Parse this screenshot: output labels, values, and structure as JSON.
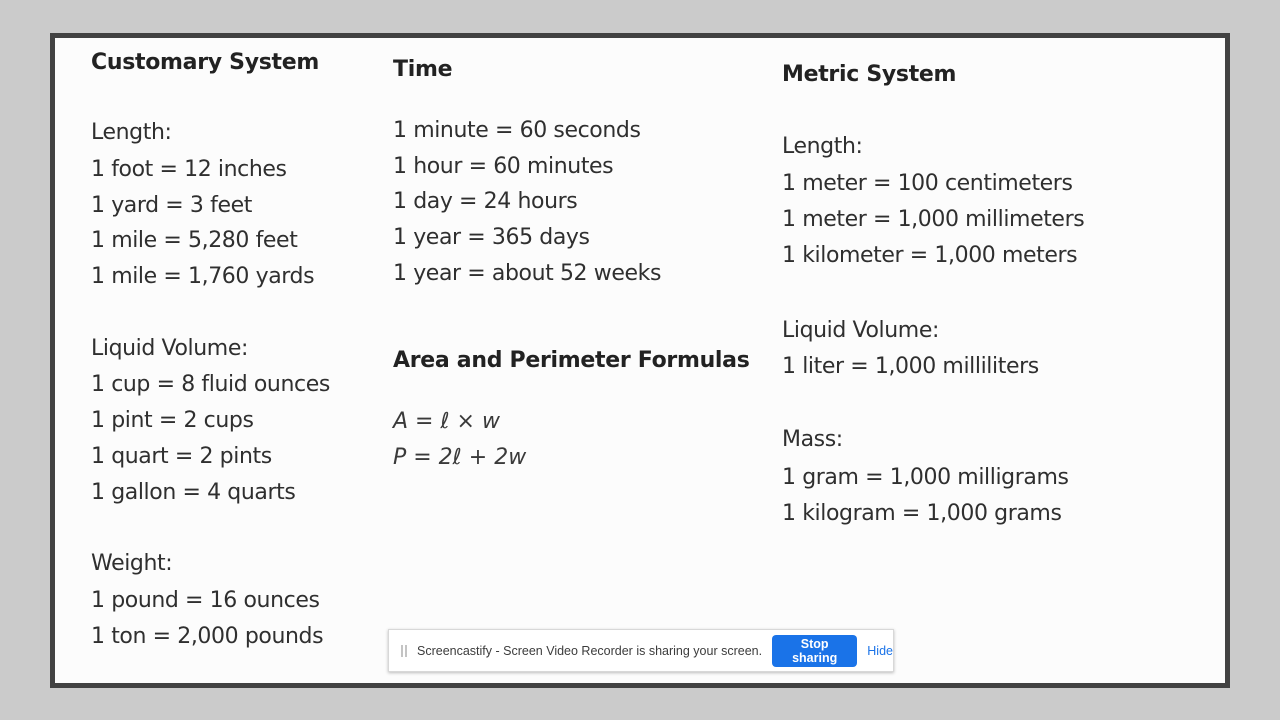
{
  "customary": {
    "title": "Customary System",
    "length": {
      "label": "Length:",
      "lines": [
        "1 foot = 12 inches",
        "1 yard = 3 feet",
        "1 mile = 5,280 feet",
        "1 mile = 1,760 yards"
      ]
    },
    "liquid_volume": {
      "label": "Liquid Volume:",
      "lines": [
        "1 cup = 8 fluid ounces",
        "1 pint = 2 cups",
        "1 quart = 2 pints",
        "1 gallon = 4 quarts"
      ]
    },
    "weight": {
      "label": "Weight:",
      "lines": [
        "1 pound = 16 ounces",
        "1 ton = 2,000 pounds"
      ]
    }
  },
  "time": {
    "title": "Time",
    "lines": [
      "1 minute = 60 seconds",
      "1 hour = 60 minutes",
      "1 day = 24 hours",
      "1 year = 365 days",
      "1 year = about 52 weeks"
    ]
  },
  "formulas": {
    "title": "Area and Perimeter Formulas",
    "lines": [
      "A = ℓ × w",
      "P = 2ℓ + 2w"
    ]
  },
  "metric": {
    "title": "Metric System",
    "length": {
      "label": "Length:",
      "lines": [
        "1 meter = 100 centimeters",
        "1 meter = 1,000 millimeters",
        "1 kilometer = 1,000 meters"
      ]
    },
    "liquid_volume": {
      "label": "Liquid Volume:",
      "lines": [
        "1 liter = 1,000 milliliters"
      ]
    },
    "mass": {
      "label": "Mass:",
      "lines": [
        "1 gram = 1,000 milligrams",
        "1 kilogram = 1,000 grams"
      ]
    }
  },
  "sharebar": {
    "message": "Screencastify - Screen Video Recorder is sharing your screen.",
    "stop_label": "Stop sharing",
    "hide_label": "Hide",
    "accent": "#1a73e8"
  }
}
